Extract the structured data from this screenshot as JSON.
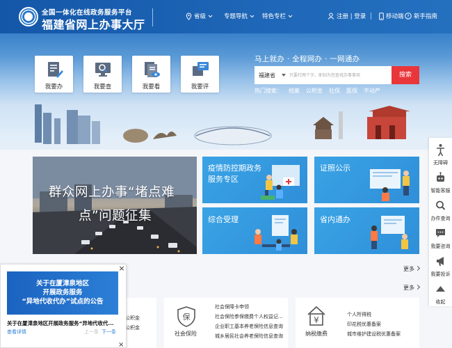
{
  "header": {
    "subtitle": "全国一体化在线政务服务平台",
    "title": "福建省网上办事大厅",
    "nav": {
      "province": "省级",
      "topics": "专题导航",
      "featured": "特色专栏",
      "auth": "注册 | 登录",
      "mobile": "移动端",
      "guide": "新手指南"
    }
  },
  "services": [
    {
      "label": "我要办"
    },
    {
      "label": "我要查"
    },
    {
      "label": "我要看"
    },
    {
      "label": "我要评"
    }
  ],
  "search": {
    "slogan": "马上就办 · 全程网办 · 一网通办",
    "scope": "福建省",
    "placeholder": "只要打两个字，即刻为您查找办事事项",
    "button": "搜索",
    "hot_label": "热门搜索：",
    "hot_items": [
      "档案",
      "公积金",
      "社保",
      "医保",
      "不动产"
    ]
  },
  "side_tools": [
    {
      "label": "无障碍",
      "icon": "accessibility-icon"
    },
    {
      "label": "智能客服",
      "icon": "robot-icon"
    },
    {
      "label": "办件查询",
      "icon": "search-icon"
    },
    {
      "label": "我要咨询",
      "icon": "chat-icon"
    },
    {
      "label": "我要投诉",
      "icon": "megaphone-icon"
    },
    {
      "label": "收起",
      "icon": "collapse-icon"
    }
  ],
  "banner": {
    "line1": "群众网上办事“堵点难",
    "line2": "点”问题征集"
  },
  "tiles": [
    {
      "title_l1": "疫情防控期政务",
      "title_l2": "服务专区"
    },
    {
      "title_l1": "证照公示",
      "title_l2": ""
    },
    {
      "title_l1": "综合受理",
      "title_l2": ""
    },
    {
      "title_l1": "省内通办",
      "title_l2": ""
    }
  ],
  "more": {
    "label1": "更多",
    "label2": "更多"
  },
  "bottom_cards": {
    "left": {
      "items": [
        "公积金",
        "公积金"
      ]
    },
    "social": {
      "title": "社会保险",
      "items": [
        "社会保障卡申领",
        "社会保险参保缴费个人权益记...",
        "企业职工基本养老保险信息查询",
        "城乡居民社会养老保险信息查询"
      ]
    },
    "tax": {
      "title": "纳税缴费",
      "items": [
        "个人所得税",
        "印花税优惠备案",
        "城市维护建设税优惠备案"
      ]
    }
  },
  "popup": {
    "image_l1": "关于在厦漳泉地区",
    "image_l2": "开展政务服务",
    "image_l3": "“异地代收代办”试点的公告",
    "caption": "关于在厦漳泉地区开展政务服务“异地代收代...",
    "link": "查看详情",
    "prev": "上一条",
    "next": "下一条"
  }
}
